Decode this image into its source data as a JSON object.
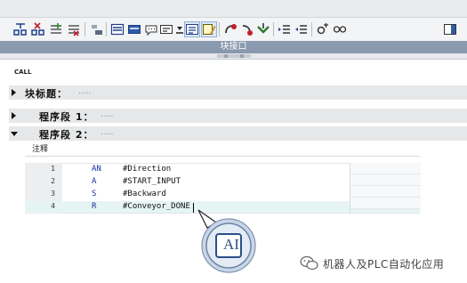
{
  "window": {
    "panel_title": "块接口"
  },
  "toolbar": {
    "buttons": [
      "insert-network-icon",
      "delete-network-icon",
      "insert-row-icon",
      "delete-row-icon",
      "move-icon",
      "absolute-operands-icon",
      "display-favorites-icon",
      "comment-icon",
      "network-comments-icon",
      "list-view-icon",
      "editor-icon",
      "go-online-icon",
      "disconnect-icon",
      "monitor-icon",
      "indent-increase-icon",
      "indent-decrease-icon",
      "compare-icon",
      "watch-glasses-icon",
      "settings-panel-icon"
    ],
    "active": [
      "list-view-icon",
      "editor-icon"
    ]
  },
  "call_label": "CALL",
  "sections": {
    "block_title": {
      "label": "块标题：",
      "comment": "....."
    },
    "network1": {
      "label": "程序段 1：",
      "comment": "....."
    },
    "network2": {
      "label": "程序段 2：",
      "comment": "....."
    }
  },
  "comment_label": "注释",
  "code": {
    "lines": [
      {
        "num": "1",
        "op": "AN",
        "operand": "#Direction"
      },
      {
        "num": "2",
        "op": "A",
        "operand": "#START_INPUT"
      },
      {
        "num": "3",
        "op": "S",
        "operand": "#Backward"
      },
      {
        "num": "4",
        "op": "R",
        "operand": "#Conveyor_DONE"
      }
    ],
    "current_line": "4"
  },
  "callout": {
    "text": "AI"
  },
  "watermark": {
    "text": "机器人及PLC自动化应用"
  },
  "colors": {
    "accent": "#8a9aae",
    "operator": "#1a2fa0",
    "current_line_bg": "#e6f5f3"
  }
}
